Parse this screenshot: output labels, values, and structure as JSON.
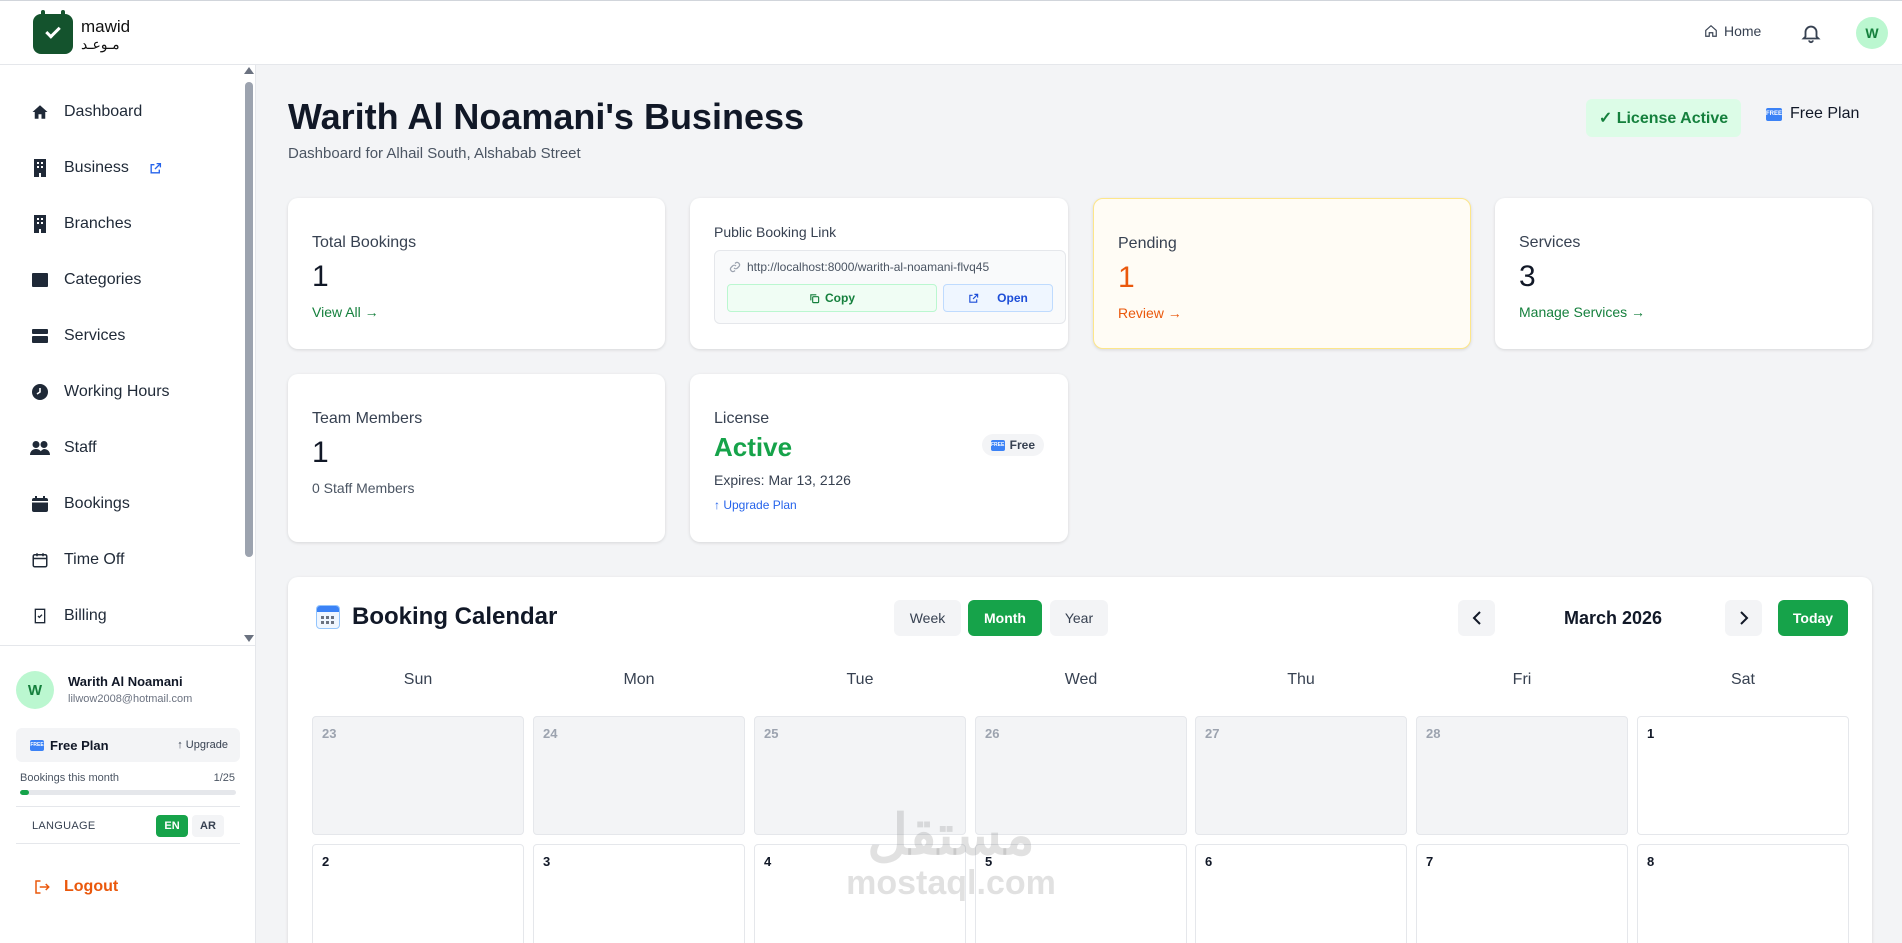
{
  "brand": {
    "name_en": "mawid",
    "name_ar": "مـوعـد"
  },
  "topbar": {
    "home_label": "Home",
    "avatar_initial": "W"
  },
  "sidebar": {
    "items": [
      {
        "label": "Dashboard",
        "icon": "home-icon"
      },
      {
        "label": "Business",
        "icon": "building-icon",
        "external": true
      },
      {
        "label": "Branches",
        "icon": "building-icon"
      },
      {
        "label": "Categories",
        "icon": "folder-icon"
      },
      {
        "label": "Services",
        "icon": "list-icon"
      },
      {
        "label": "Working Hours",
        "icon": "clock-icon"
      },
      {
        "label": "Staff",
        "icon": "users-icon"
      },
      {
        "label": "Bookings",
        "icon": "calendar-icon"
      },
      {
        "label": "Time Off",
        "icon": "calendar-off-icon"
      },
      {
        "label": "Billing",
        "icon": "receipt-icon"
      }
    ],
    "user": {
      "initial": "W",
      "name": "Warith Al Noamani",
      "email": "lilwow2008@hotmail.com"
    },
    "plan": {
      "name": "Free Plan",
      "upgrade_label": "↑ Upgrade",
      "free_badge": "FREE"
    },
    "usage": {
      "label": "Bookings this month",
      "count": "1/25",
      "fraction": 0.04
    },
    "language": {
      "label": "LANGUAGE",
      "en": "EN",
      "ar": "AR",
      "selected": "EN"
    },
    "logout_label": "Logout"
  },
  "header": {
    "title": "Warith Al Noamani's Business",
    "subtitle": "Dashboard for Alhail South, Alshabab Street",
    "license_status": "✓ License Active",
    "plan_label": "Free Plan"
  },
  "cards": {
    "total_bookings": {
      "label": "Total Bookings",
      "value": "1",
      "link": "View All →"
    },
    "booking_link": {
      "label": "Public Booking Link",
      "url": "http://localhost:8000/warith-al-noamani-flvq45",
      "copy": "Copy",
      "open": "Open"
    },
    "pending": {
      "label": "Pending",
      "value": "1",
      "link": "Review →"
    },
    "services": {
      "label": "Services",
      "value": "3",
      "link": "Manage Services →"
    },
    "team": {
      "label": "Team Members",
      "value": "1",
      "sub": "0 Staff Members"
    },
    "license": {
      "label": "License",
      "status": "Active",
      "badge": "Free",
      "expires": "Expires: Mar 13, 2126",
      "upgrade": "↑ Upgrade Plan"
    }
  },
  "calendar": {
    "title": "Booking Calendar",
    "views": [
      "Week",
      "Month",
      "Year"
    ],
    "active_view": "Month",
    "month_label": "March 2026",
    "today_label": "Today",
    "weekdays": [
      "Sun",
      "Mon",
      "Tue",
      "Wed",
      "Thu",
      "Fri",
      "Sat"
    ],
    "weeks": [
      [
        {
          "day": "23",
          "muted": true
        },
        {
          "day": "24",
          "muted": true
        },
        {
          "day": "25",
          "muted": true
        },
        {
          "day": "26",
          "muted": true
        },
        {
          "day": "27",
          "muted": true
        },
        {
          "day": "28",
          "muted": true
        },
        {
          "day": "1",
          "muted": false
        }
      ],
      [
        {
          "day": "2",
          "muted": false
        },
        {
          "day": "3",
          "muted": false
        },
        {
          "day": "4",
          "muted": false
        },
        {
          "day": "5",
          "muted": false
        },
        {
          "day": "6",
          "muted": false
        },
        {
          "day": "7",
          "muted": false
        },
        {
          "day": "8",
          "muted": false
        }
      ]
    ]
  },
  "watermark": {
    "ar": "مستقل",
    "en": "mostaql.com"
  }
}
